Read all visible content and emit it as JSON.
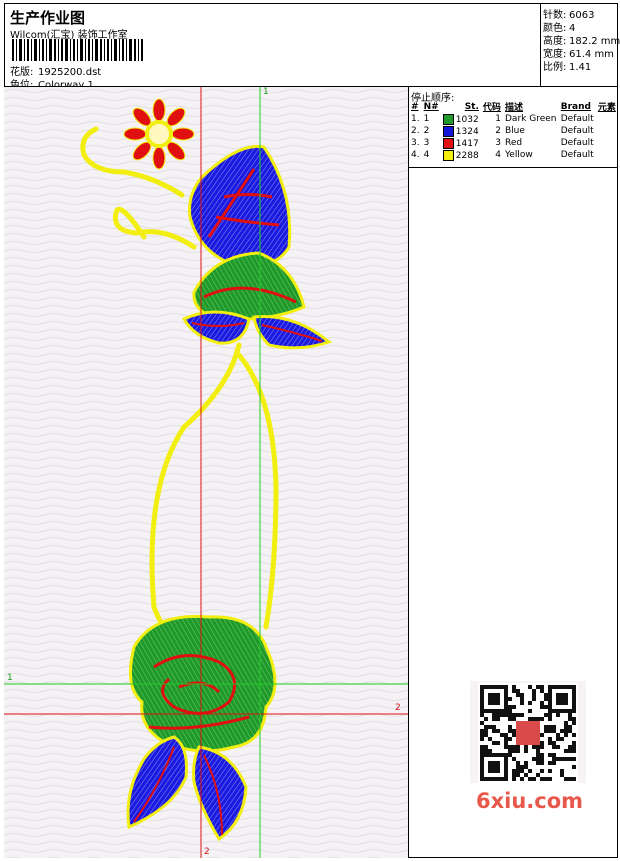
{
  "header": {
    "title": "生产作业图",
    "company": "Wilcom(汇宝) 装饰工作室",
    "design_label": "花版:",
    "design_value": "1925200.dst",
    "colorway_label": "色位:",
    "colorway_value": "Colorway 1"
  },
  "stats": [
    {
      "label": "针数:",
      "value": "6063"
    },
    {
      "label": "颜色:",
      "value": "4"
    },
    {
      "label": "高度:",
      "value": "182.2 mm"
    },
    {
      "label": "宽度:",
      "value": "61.4 mm"
    },
    {
      "label": "比例:",
      "value": "1.41"
    }
  ],
  "stop_sequence": {
    "title": "停止顺序:",
    "columns": [
      "#",
      "N#",
      "St.",
      "代码",
      "描述",
      "Brand",
      "元素"
    ],
    "rows": [
      {
        "num": "1.",
        "n": "1",
        "color": "#1f9a2a",
        "stitches": "1032",
        "code": "1",
        "desc": "Dark Green",
        "brand": "Default"
      },
      {
        "num": "2.",
        "n": "2",
        "color": "#1414d6",
        "stitches": "1324",
        "code": "2",
        "desc": "Blue",
        "brand": "Default"
      },
      {
        "num": "3.",
        "n": "3",
        "color": "#e01010",
        "stitches": "1417",
        "code": "3",
        "desc": "Red",
        "brand": "Default"
      },
      {
        "num": "4.",
        "n": "4",
        "color": "#f2ee10",
        "stitches": "2288",
        "code": "4",
        "desc": "Yellow",
        "brand": "Default"
      }
    ]
  },
  "guides": {
    "green_h_label": "1",
    "green_v_label": "1",
    "red_h_label": "2",
    "red_v_label": "2"
  },
  "watermark": "6xiu.com",
  "colors": {
    "green": "#1f9a2a",
    "blue": "#1414d6",
    "red": "#e01010",
    "yellow": "#f2ee10"
  }
}
